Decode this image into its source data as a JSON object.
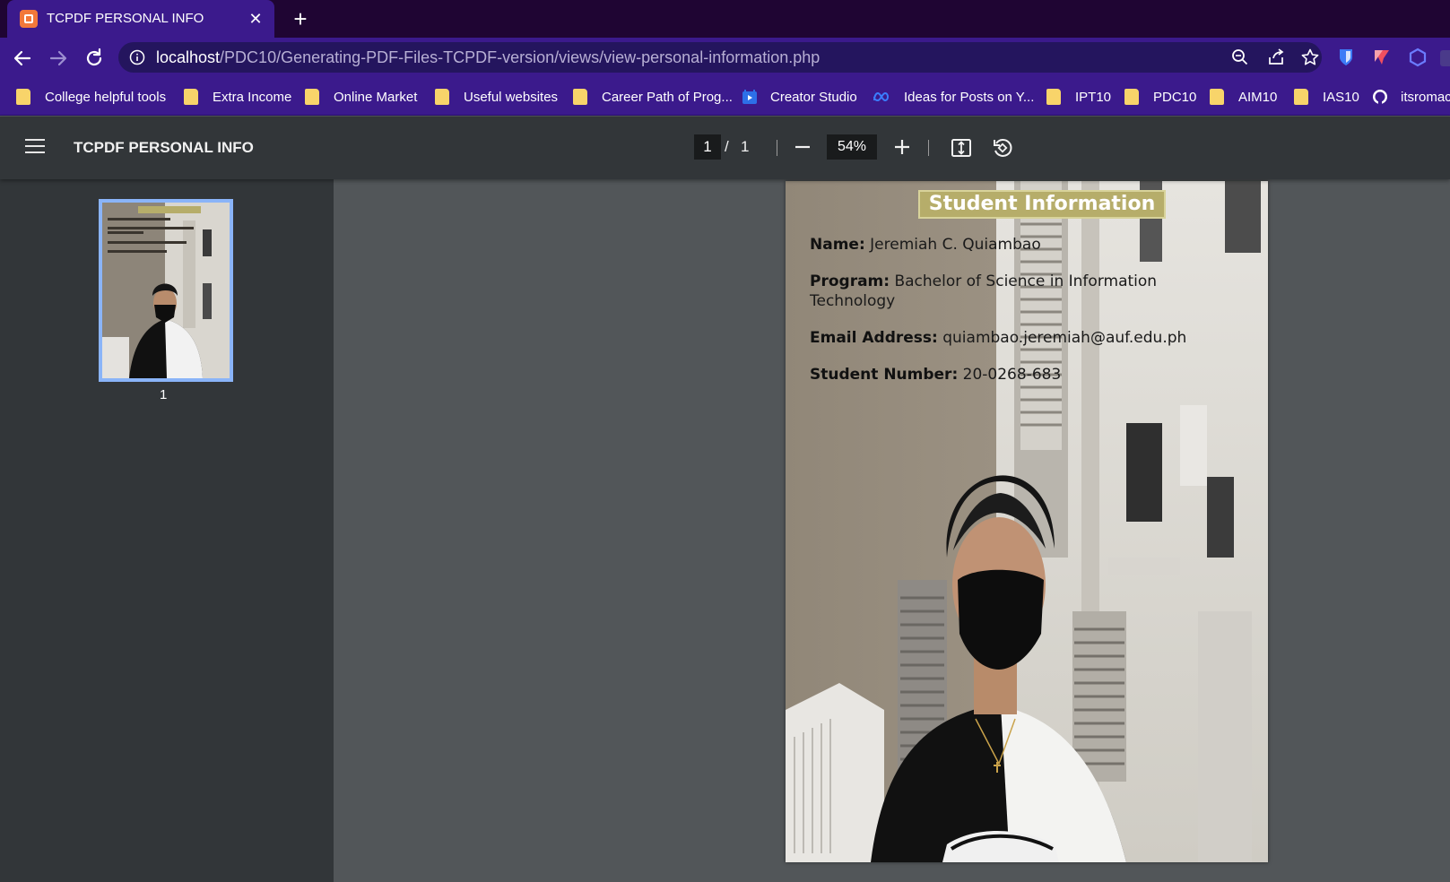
{
  "browser": {
    "tab_title": "TCPDF PERSONAL INFO",
    "url_host": "localhost",
    "url_path": "/PDC10/Generating-PDF-Files-TCPDF-version/views/view-personal-information.php",
    "bookmarks": [
      {
        "label": "College helpful tools",
        "icon": "folder-icon"
      },
      {
        "label": "Extra Income",
        "icon": "folder-icon"
      },
      {
        "label": "Online Market",
        "icon": "folder-icon"
      },
      {
        "label": "Useful websites",
        "icon": "folder-icon"
      },
      {
        "label": "Career Path of Prog...",
        "icon": "folder-icon"
      },
      {
        "label": "Creator Studio",
        "icon": "creator-studio-icon"
      },
      {
        "label": "Ideas for Posts on Y...",
        "icon": "meta-icon"
      },
      {
        "label": "IPT10",
        "icon": "folder-icon"
      },
      {
        "label": "PDC10",
        "icon": "folder-icon"
      },
      {
        "label": "AIM10",
        "icon": "folder-icon"
      },
      {
        "label": "IAS10",
        "icon": "folder-icon"
      },
      {
        "label": "itsromac",
        "icon": "github-icon"
      }
    ]
  },
  "viewer": {
    "title": "TCPDF PERSONAL INFO",
    "current_page": "1",
    "separator": "/",
    "total_pages": "1",
    "zoom": "54%",
    "thumbnail_label": "1"
  },
  "document": {
    "heading": "Student Information",
    "fields": [
      {
        "label": "Name:",
        "value": "Jeremiah C. Quiambao"
      },
      {
        "label": "Program:",
        "value": "Bachelor of Science in Information Technology"
      },
      {
        "label": "Email Address:",
        "value": "quiambao.jeremiah@auf.edu.ph"
      },
      {
        "label": "Student Number:",
        "value": "20-0268-683"
      }
    ]
  },
  "colors": {
    "tabstrip": "#1f0533",
    "toolbar": "#3b1a8c",
    "viewer_bar": "#323639",
    "viewer_bg": "#525659",
    "heading_bg": "#b6ad6a",
    "thumb_border": "#8ab4f8"
  }
}
